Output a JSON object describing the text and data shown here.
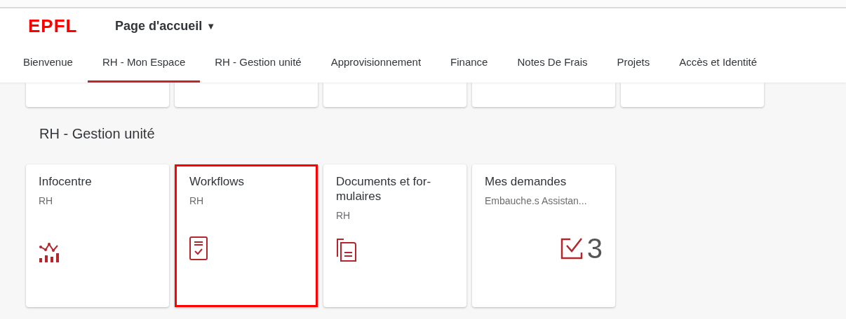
{
  "header": {
    "logo": "EPFL",
    "title": "Page d'accueil",
    "title_icon": "▼"
  },
  "tabs": [
    {
      "label": "Bienvenue",
      "selected": false
    },
    {
      "label": "RH - Mon Espace",
      "selected": true
    },
    {
      "label": "RH - Gestion unité",
      "selected": false
    },
    {
      "label": "Approvisionnement",
      "selected": false
    },
    {
      "label": "Finance",
      "selected": false
    },
    {
      "label": "Notes De Frais",
      "selected": false
    },
    {
      "label": "Projets",
      "selected": false
    },
    {
      "label": "Accès et Identité",
      "selected": false
    }
  ],
  "previous_section": {
    "tiles": [
      {
        "kind": "blank"
      },
      {
        "kind": "blank"
      },
      {
        "kind": "blank"
      },
      {
        "kind": "blank"
      },
      {
        "kind": "blank"
      }
    ]
  },
  "section": {
    "title": "RH - Gestion unité",
    "tiles": [
      {
        "title": "Infocentre",
        "subtitle": "RH",
        "kind": "chart",
        "highlighted": false
      },
      {
        "title": "Workflows",
        "subtitle": "RH",
        "kind": "document-check",
        "highlighted": true
      },
      {
        "title": "Documents et for-\nmulaires",
        "subtitle": "RH",
        "kind": "documents",
        "highlighted": false
      },
      {
        "title": "Mes demandes",
        "subtitle": "Embauche.s Assistan...",
        "kind": "task-count",
        "count": "3",
        "highlighted": false
      }
    ]
  }
}
